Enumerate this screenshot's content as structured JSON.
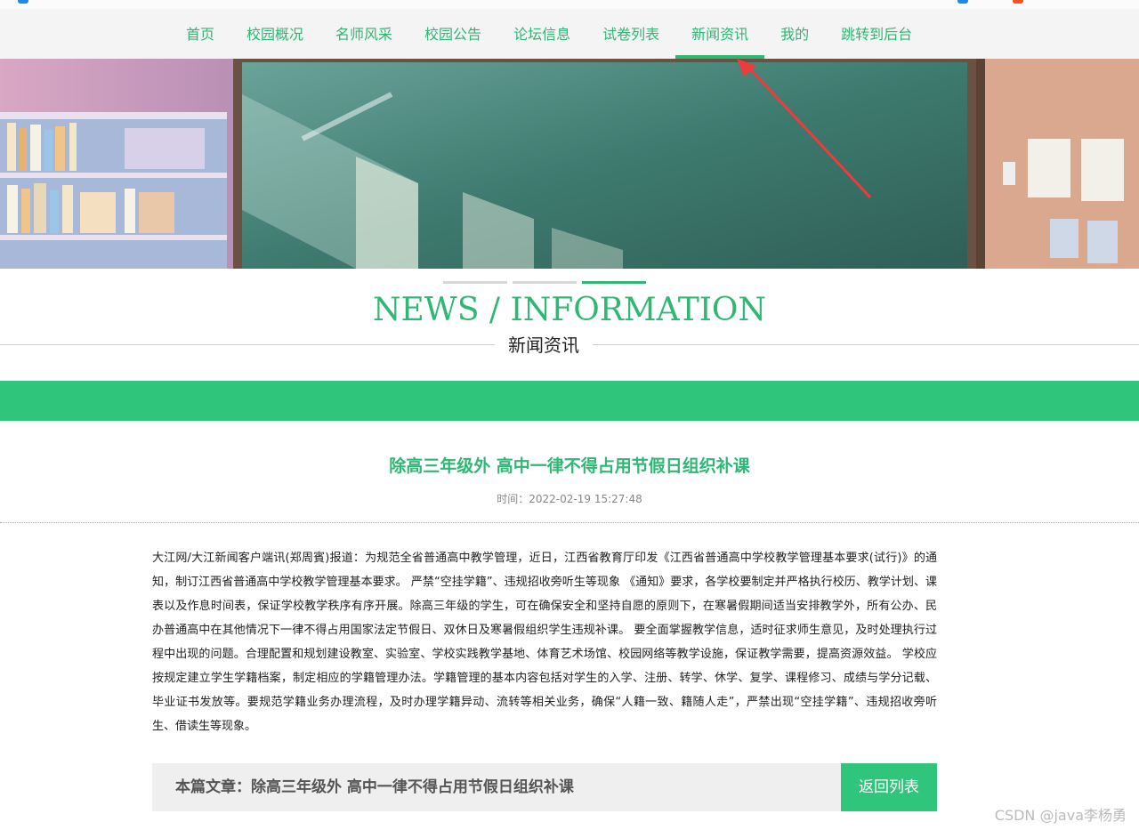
{
  "nav": {
    "items": [
      {
        "label": "首页"
      },
      {
        "label": "校园概况"
      },
      {
        "label": "名师风采"
      },
      {
        "label": "校园公告"
      },
      {
        "label": "论坛信息"
      },
      {
        "label": "试卷列表"
      },
      {
        "label": "新闻资讯",
        "active": true
      },
      {
        "label": "我的"
      },
      {
        "label": "跳转到后台"
      }
    ]
  },
  "section": {
    "title_en": "NEWS / INFORMATION",
    "title_cn": "新闻资讯"
  },
  "article": {
    "title": "除高三年级外 高中一律不得占用节假日组织补课",
    "meta": "时间：2022-02-19 15:27:48",
    "body": "大江网/大江新闻客户端讯(郑周賓)报道：为规范全省普通高中教学管理，近日，江西省教育厅印发《江西省普通高中学校教学管理基本要求(试行)》的通知，制订江西省普通高中学校教学管理基本要求。 严禁“空挂学籍”、违规招收旁听生等现象 《通知》要求，各学校要制定并严格执行校历、教学计划、课表以及作息时间表，保证学校教学秩序有序开展。除高三年级的学生，可在确保安全和坚持自愿的原则下，在寒暑假期间适当安排教学外，所有公办、民办普通高中在其他情况下一律不得占用国家法定节假日、双休日及寒暑假组织学生违规补课。 要全面掌握教学信息，适时征求师生意见，及时处理执行过程中出现的问题。合理配置和规划建设教室、实验室、学校实践教学基地、体育艺术场馆、校园网络等教学设施，保证教学需要，提高资源效益。 学校应按规定建立学生学籍档案，制定相应的学籍管理办法。学籍管理的基本内容包括对学生的入学、注册、转学、休学、复学、课程修习、成绩与学分记载、毕业证书发放等。要规范学籍业务办理流程，及时办理学籍异动、流转等相关业务，确保“人籍一致、籍随人走”，严禁出现“空挂学籍”、违规招收旁听生、借读生等现象。"
  },
  "footer": {
    "current_label": "本篇文章：除高三年级外 高中一律不得占用节假日组织补课",
    "back_label": "返回列表"
  },
  "watermark": "CSDN @java李杨勇",
  "colors": {
    "accent": "#2fb774",
    "bar": "#2fc57b"
  }
}
